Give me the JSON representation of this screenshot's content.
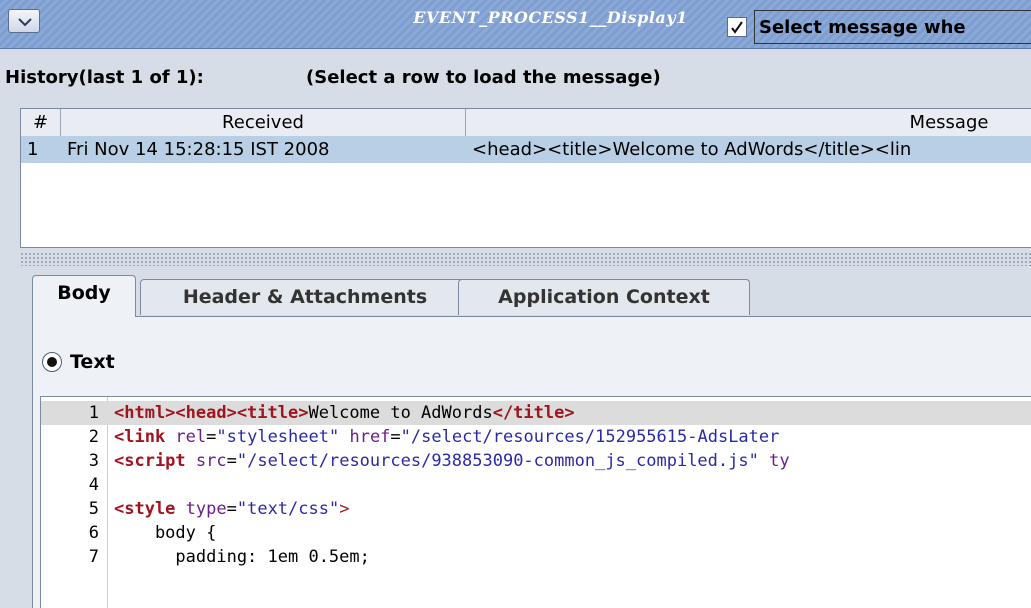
{
  "window": {
    "title": "EVENT_PROCESS1__Display1"
  },
  "history": {
    "label": "History(last 1 of 1):",
    "hint": "(Select a row to load the message)",
    "auto_select_checked": true,
    "auto_select_label": "Select message whe"
  },
  "table": {
    "columns": [
      "#",
      "Received",
      "Message"
    ],
    "rows": [
      {
        "index": "1",
        "received": "Fri Nov 14 15:28:15 IST 2008",
        "message": "<head><title>Welcome to AdWords</title><lin"
      }
    ]
  },
  "tabs": [
    {
      "label": "Body",
      "active": true
    },
    {
      "label": "Header & Attachments",
      "active": false
    },
    {
      "label": "Application Context",
      "active": false
    }
  ],
  "format": {
    "selected": "Text"
  },
  "code": {
    "lines": [
      {
        "n": "1",
        "highlight": true,
        "parts": [
          {
            "k": "tg",
            "t": "<html><head><title>"
          },
          {
            "k": "pl",
            "t": "Welcome to AdWords"
          },
          {
            "k": "tg",
            "t": "</title>"
          }
        ]
      },
      {
        "n": "2",
        "parts": [
          {
            "k": "tg",
            "t": "<link "
          },
          {
            "k": "at",
            "t": "rel"
          },
          {
            "k": "pl",
            "t": "="
          },
          {
            "k": "st",
            "t": "\"stylesheet\""
          },
          {
            "k": "pl",
            "t": " "
          },
          {
            "k": "at",
            "t": "href"
          },
          {
            "k": "pl",
            "t": "="
          },
          {
            "k": "st",
            "t": "\"/select/resources/152955615-AdsLater"
          }
        ]
      },
      {
        "n": "3",
        "parts": [
          {
            "k": "tg",
            "t": "<script "
          },
          {
            "k": "at",
            "t": "src"
          },
          {
            "k": "pl",
            "t": "="
          },
          {
            "k": "st",
            "t": "\"/select/resources/938853090-common_js_compiled.js\""
          },
          {
            "k": "pl",
            "t": " "
          },
          {
            "k": "at",
            "t": "ty"
          }
        ]
      },
      {
        "n": "4",
        "parts": []
      },
      {
        "n": "5",
        "parts": [
          {
            "k": "tg",
            "t": "<style "
          },
          {
            "k": "at",
            "t": "type"
          },
          {
            "k": "pl",
            "t": "="
          },
          {
            "k": "st",
            "t": "\"text/css\""
          },
          {
            "k": "lt",
            "t": ">"
          }
        ]
      },
      {
        "n": "6",
        "parts": [
          {
            "k": "pl",
            "t": "    body {"
          }
        ]
      },
      {
        "n": "7",
        "parts": [
          {
            "k": "pl",
            "t": "      padding: 1em 0.5em;"
          }
        ]
      }
    ]
  },
  "colors": {
    "titlebar": "#8aa8d8",
    "selected_row": "#b8cfe6",
    "tag": "#a0141e",
    "attr": "#6a1e8c",
    "string": "#2a2aa8"
  }
}
